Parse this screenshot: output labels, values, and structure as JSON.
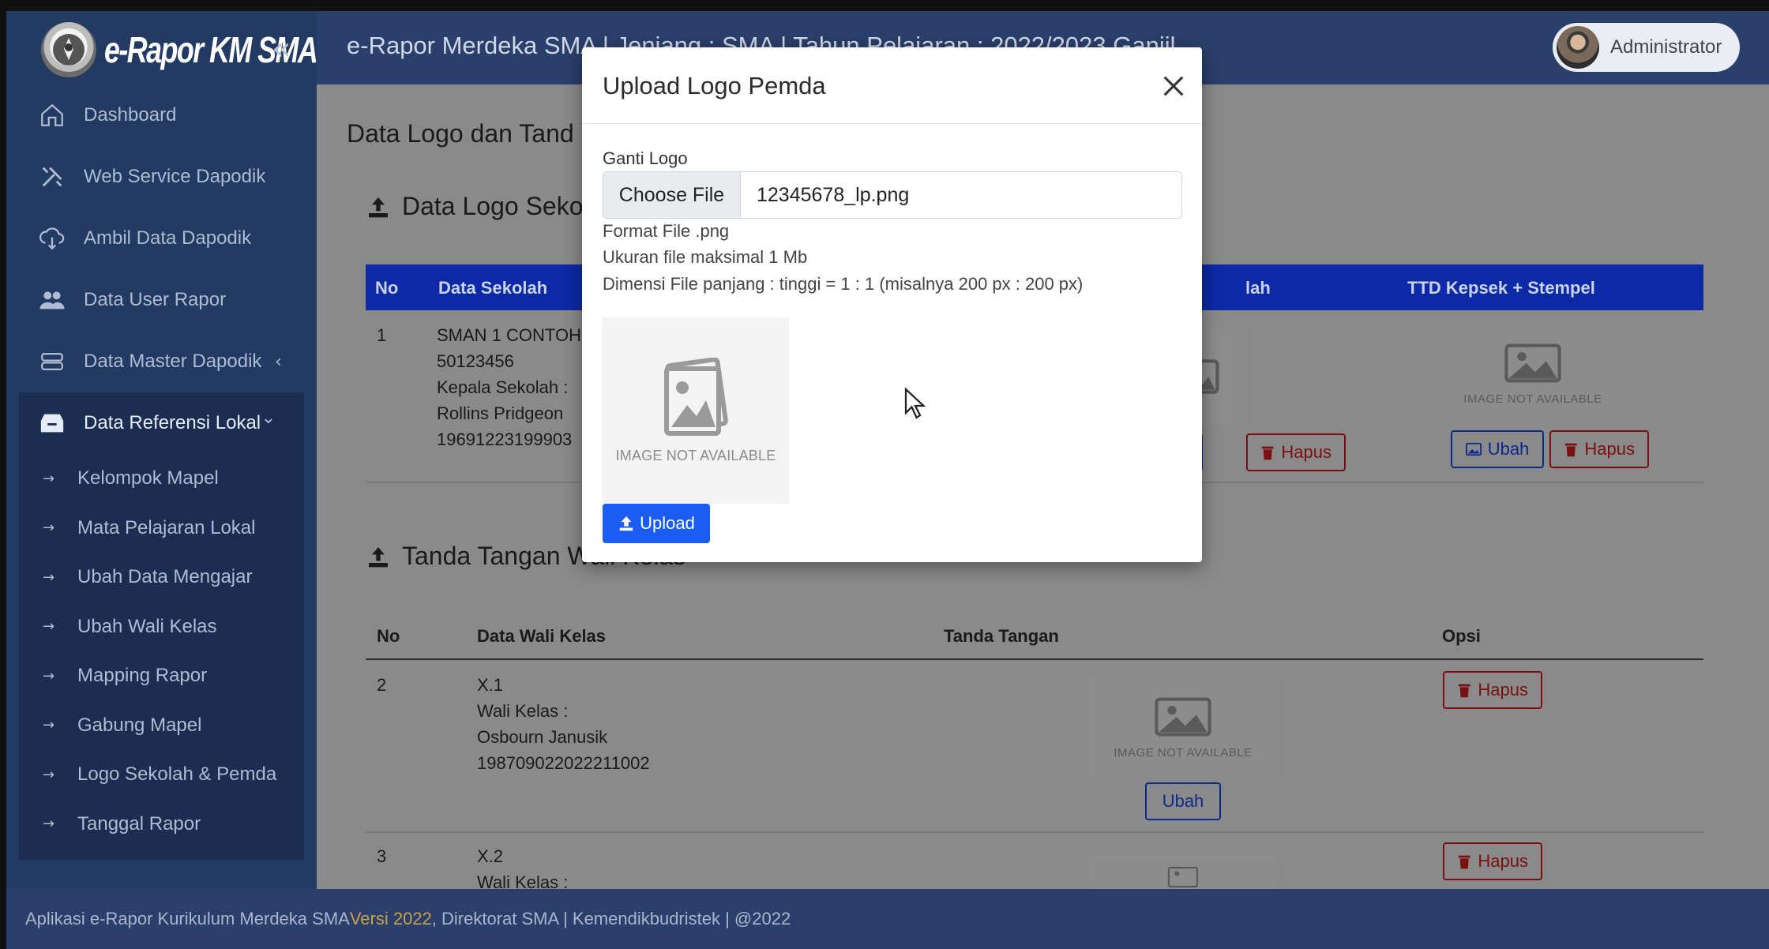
{
  "app": {
    "brand": "e-Rapor KM SMA",
    "header_title": "e-Rapor Merdeka SMA | Jenjang : SMA | Tahun Pelajaran : 2022/2023 Ganjil",
    "user": "Administrator"
  },
  "sidebar": {
    "items": [
      {
        "label": "Dashboard",
        "icon": "home-icon"
      },
      {
        "label": "Web Service Dapodik",
        "icon": "tools-icon"
      },
      {
        "label": "Ambil Data Dapodik",
        "icon": "cloud-download-icon"
      },
      {
        "label": "Data User Rapor",
        "icon": "users-icon"
      },
      {
        "label": "Data Master Dapodik",
        "icon": "database-icon",
        "chevron": "‹"
      },
      {
        "label": "Data Referensi Lokal",
        "icon": "archive-icon",
        "chevron": "⌄",
        "active": true
      }
    ],
    "subitems": [
      "Kelompok Mapel",
      "Mata Pelajaran Lokal",
      "Ubah Data Mengajar",
      "Ubah Wali Kelas",
      "Mapping Rapor",
      "Gabung Mapel",
      "Logo Sekolah & Pemda",
      "Tanggal Rapor"
    ]
  },
  "main": {
    "page_title": "Data Logo dan Tand",
    "section1_title": "Data Logo Seko",
    "table1": {
      "headers": {
        "no": "No",
        "data_sekolah": "Data Sekolah",
        "logo_pemda_partial": "lah",
        "ttd": "TTD Kepsek + Stempel"
      },
      "row": {
        "no": "1",
        "lines": [
          "SMAN 1 CONTOH",
          "50123456",
          "Kepala Sekolah :",
          "Rollins Pridgeon",
          "19691223199903"
        ]
      },
      "ubah_partial": "bah",
      "ubah": "Ubah",
      "hapus": "Hapus"
    },
    "section2_title": "Tanda Tangan Wali Kelas",
    "table2": {
      "headers": {
        "no": "No",
        "data_wali": "Data Wali Kelas",
        "ttd": "Tanda Tangan",
        "opsi": "Opsi"
      },
      "rows": [
        {
          "no": "2",
          "lines": [
            "X.1",
            "Wali Kelas :",
            "Osbourn Janusik",
            "198709022022211002"
          ]
        },
        {
          "no": "3",
          "lines": [
            "X.2",
            "Wali Kelas :"
          ]
        }
      ],
      "ubah": "Ubah",
      "hapus": "Hapus"
    },
    "image_not_available": "IMAGE NOT AVAILABLE"
  },
  "modal": {
    "title": "Upload Logo Pemda",
    "field_label": "Ganti Logo",
    "choose_file": "Choose File",
    "file_name": "12345678_lp.png",
    "help": [
      "Format File .png",
      "Ukuran file maksimal 1 Mb",
      "Dimensi File panjang : tinggi = 1 : 1 (misalnya 200 px : 200 px)"
    ],
    "preview_text": "IMAGE NOT AVAILABLE",
    "upload": "Upload"
  },
  "footer": {
    "prefix": "Aplikasi e-Rapor Kurikulum Merdeka SMA ",
    "versi": "Versi 2022",
    "suffix": ", Direktorat SMA | Kemendikbudristek | @2022"
  },
  "colors": {
    "sidebar": "#233a63",
    "topbar": "#2a3f6b",
    "table_header_blue": "#0d2aa6",
    "upload_button": "#1b5cf5",
    "danger": "#7a1010",
    "versi_accent": "#c8a24a"
  }
}
